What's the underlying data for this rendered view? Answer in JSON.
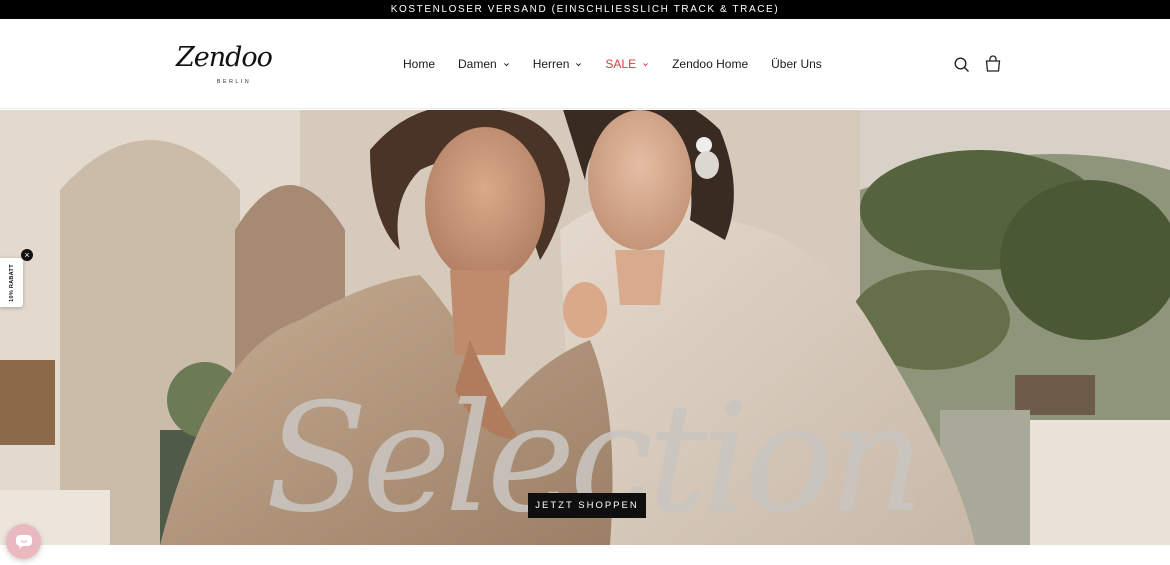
{
  "announcement": {
    "text": "KOSTENLOSER VERSAND (EINSCHLIESSLICH TRACK & TRACE)"
  },
  "header": {
    "logo": {
      "wordmark": "Zendoo",
      "subline": "BERLIN"
    },
    "nav": [
      {
        "label": "Home",
        "has_dropdown": false
      },
      {
        "label": "Damen",
        "has_dropdown": true
      },
      {
        "label": "Herren",
        "has_dropdown": true
      },
      {
        "label": "SALE",
        "has_dropdown": true,
        "color": "#d83b3b"
      },
      {
        "label": "Zendoo Home",
        "has_dropdown": false
      },
      {
        "label": "Über Uns",
        "has_dropdown": false
      }
    ],
    "icons": [
      "search-icon",
      "cart-icon"
    ]
  },
  "hero": {
    "script_text": "Selection",
    "cta_label": "JETZT SHOPPEN"
  },
  "discount_tab": {
    "label": "10% RABATT",
    "close_symbol": "×"
  },
  "chat": {
    "icon": "chat-icon"
  },
  "colors": {
    "accent_sale": "#d83b3b",
    "bar": "#000000",
    "cta": "#0f0f0f"
  }
}
